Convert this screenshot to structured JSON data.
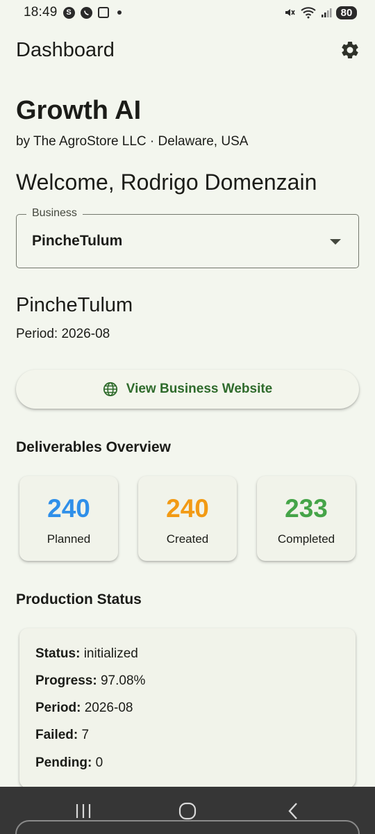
{
  "status_bar": {
    "time": "18:49",
    "battery": "80",
    "icons": [
      "skype-icon",
      "whatsapp-icon",
      "screenshot-icon",
      "dot-icon",
      "mute-icon",
      "wifi-icon",
      "signal-icon"
    ]
  },
  "app_bar": {
    "title": "Dashboard",
    "settings_icon": "gear-icon"
  },
  "org": {
    "title": "Growth AI",
    "subtitle": "by The AgroStore LLC · Delaware, USA"
  },
  "welcome": "Welcome, Rodrigo Domenzain",
  "business_select": {
    "label": "Business",
    "value": "PincheTulum"
  },
  "business": {
    "name": "PincheTulum",
    "period": "Period: 2026-08"
  },
  "website_button": {
    "label": "View Business Website",
    "icon": "globe-icon"
  },
  "deliverables": {
    "heading": "Deliverables Overview",
    "cards": [
      {
        "value": "240",
        "label": "Planned",
        "color": "#2f8fe9"
      },
      {
        "value": "240",
        "label": "Created",
        "color": "#f29a14"
      },
      {
        "value": "233",
        "label": "Completed",
        "color": "#45a448"
      }
    ]
  },
  "production": {
    "heading": "Production Status",
    "rows": [
      {
        "key": "Status:",
        "value": "initialized"
      },
      {
        "key": "Progress:",
        "value": "97.08%"
      },
      {
        "key": "Period:",
        "value": "2026-08"
      },
      {
        "key": "Failed:",
        "value": "7"
      },
      {
        "key": "Pending:",
        "value": "0"
      }
    ]
  },
  "colors": {
    "background": "#f3f6ee",
    "accent_green": "#2f6b2c",
    "navbar": "#363636"
  }
}
